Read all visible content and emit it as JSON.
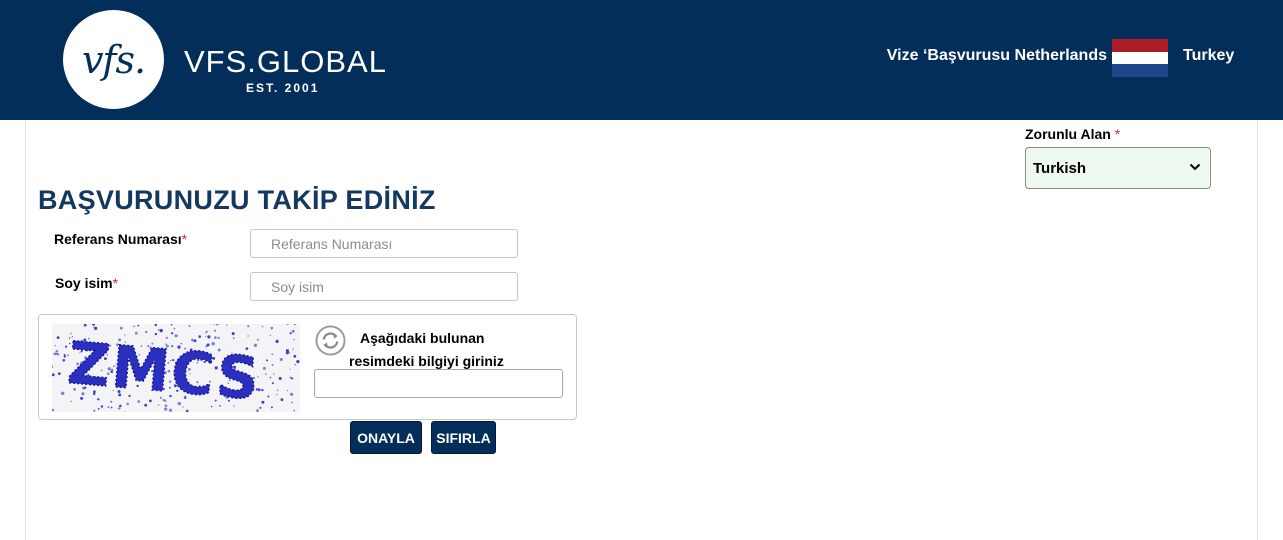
{
  "header": {
    "logo_mark": "vfs.",
    "brand_name": "VFS.GLOBAL",
    "brand_est": "EST. 2001",
    "title": "Vize ‘Başvurusu Netherlands",
    "country": "Turkey",
    "flag_colors": [
      "#ae1c28",
      "#ffffff",
      "#21468b"
    ]
  },
  "language": {
    "label": "Zorunlu Alan",
    "required_mark": "*",
    "selected": "Turkish"
  },
  "form": {
    "title": "BAŞVURUNUZU TAKİP EDİNİZ",
    "reference": {
      "label": "Referans Numarası",
      "required_mark": "*",
      "value": "",
      "placeholder": "Referans Numarası"
    },
    "surname": {
      "label": "Soy isim",
      "required_mark": "*",
      "value": "",
      "placeholder": "Soy isim"
    },
    "captcha": {
      "image_text": "ZMCS",
      "instruction_line1": "Aşağıdaki bulunan",
      "instruction_line2": "resimdeki bilgiyi giriniz",
      "value": ""
    },
    "buttons": {
      "confirm": "ONAYLA",
      "reset": "SIFIRLA"
    }
  },
  "colors": {
    "header_bg": "#042e5a",
    "title_color": "#14385f",
    "required_color": "#d9232d",
    "select_bg": "#eef9ef"
  }
}
